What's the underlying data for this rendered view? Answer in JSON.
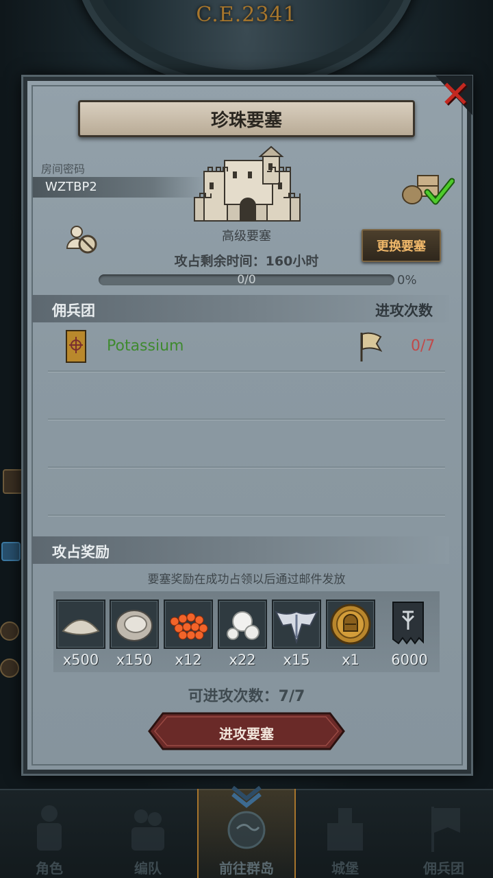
{
  "header": {
    "era": "C.E.2341"
  },
  "modal": {
    "title": "珍珠要塞",
    "room_code_label": "房间密码",
    "room_code": "WZTBP2",
    "fortress_level": "高级要塞",
    "change_button": "更换要塞",
    "time_left": "攻占剩余时间：160小时",
    "progress_text": "0/0",
    "progress_percent": "0%",
    "progress_fraction": 0,
    "mercenary_header": "佣兵团",
    "attack_count_header": "进攻次数",
    "mercenaries": [
      {
        "name": "Potassium",
        "attacks": "0/7"
      }
    ],
    "rewards_header": "攻占奖励",
    "rewards_note": "要塞奖励在成功占领以后通过邮件发放",
    "rewards": [
      {
        "icon": "sand-icon",
        "qty": "x500"
      },
      {
        "icon": "oyster-icon",
        "qty": "x150"
      },
      {
        "icon": "fish-roe-icon",
        "qty": "x12"
      },
      {
        "icon": "pearl-icon",
        "qty": "x22"
      },
      {
        "icon": "winged-emblem-icon",
        "qty": "x15"
      },
      {
        "icon": "knight-medal-icon",
        "qty": "x1"
      },
      {
        "icon": "war-banner-icon",
        "qty": "6000"
      }
    ],
    "attacks_available": "可进攻次数：7/7",
    "attack_button": "进攻要塞"
  },
  "bottom_nav": [
    {
      "label": "角色",
      "icon": "character-icon"
    },
    {
      "label": "编队",
      "icon": "formation-icon"
    },
    {
      "label": "前往群岛",
      "icon": "archipelago-icon",
      "active": true
    },
    {
      "label": "城堡",
      "icon": "castle-icon"
    },
    {
      "label": "佣兵团",
      "icon": "mercenary-icon"
    }
  ],
  "colors": {
    "accent_gold": "#a8752c",
    "merc_name": "#3f8a2f",
    "attack_count": "#c04a4a",
    "close_red": "#c42820"
  }
}
